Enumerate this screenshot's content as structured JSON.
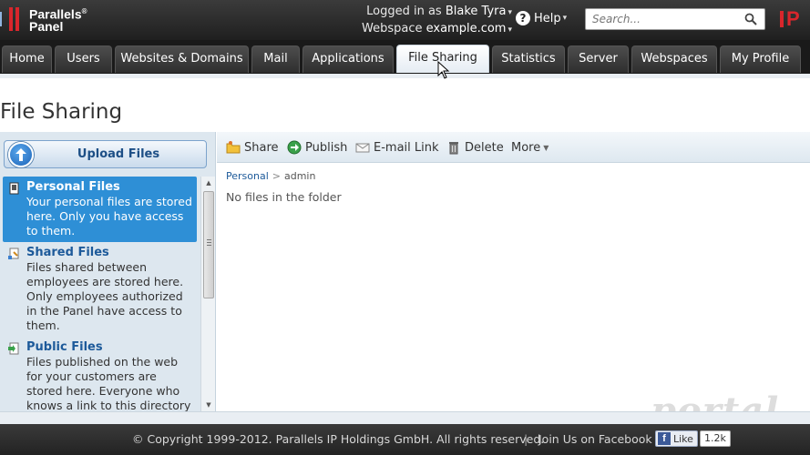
{
  "brand": {
    "name_line1": "Parallels",
    "name_line2": "Panel",
    "reg_mark": "®",
    "right_fragment": "P"
  },
  "header": {
    "logged_in_label": "Logged in as",
    "user_name": "Blake Tyra",
    "webspace_label": "Webspace",
    "webspace_value": "example.com",
    "help_label": "Help",
    "search_placeholder": "Search..."
  },
  "nav": {
    "tabs": [
      {
        "label": "Home",
        "active": false
      },
      {
        "label": "Users",
        "active": false
      },
      {
        "label": "Websites & Domains",
        "active": false
      },
      {
        "label": "Mail",
        "active": false
      },
      {
        "label": "Applications",
        "active": false
      },
      {
        "label": "File Sharing",
        "active": true
      },
      {
        "label": "Statistics",
        "active": false
      },
      {
        "label": "Server",
        "active": false
      },
      {
        "label": "Webspaces",
        "active": false
      },
      {
        "label": "My Profile",
        "active": false
      }
    ]
  },
  "page": {
    "title": "File Sharing"
  },
  "sidebar": {
    "upload_label": "Upload Files",
    "folders": [
      {
        "name": "Personal Files",
        "description": "Your personal files are stored here. Only you have access to them.",
        "active": true,
        "icon": "personal-folder-icon"
      },
      {
        "name": "Shared Files",
        "description": "Files shared between employees are stored here. Only employees authorized in the Panel have access to them.",
        "active": false,
        "icon": "shared-folder-icon"
      },
      {
        "name": "Public Files",
        "description": "Files published on the web for your customers are stored here. Everyone who knows a link to this directory or its",
        "active": false,
        "icon": "public-folder-icon"
      }
    ]
  },
  "toolbar": {
    "share_label": "Share",
    "publish_label": "Publish",
    "email_link_label": "E-mail Link",
    "delete_label": "Delete",
    "more_label": "More"
  },
  "content": {
    "breadcrumb_root": "Personal",
    "breadcrumb_sep": ">",
    "breadcrumb_current": "admin",
    "empty_message": "No files in the folder"
  },
  "footer": {
    "copyright": "© Copyright 1999-2012. Parallels IP Holdings GmbH. All rights reserved.",
    "separator": "|",
    "join_facebook": "Join Us on Facebook",
    "like_label": "Like",
    "like_count": "1.2k"
  },
  "watermark": "portal",
  "colors": {
    "accent_red": "#d9262c",
    "active_folder_bg": "#2e8fd6",
    "link_blue": "#1d5a9a"
  }
}
